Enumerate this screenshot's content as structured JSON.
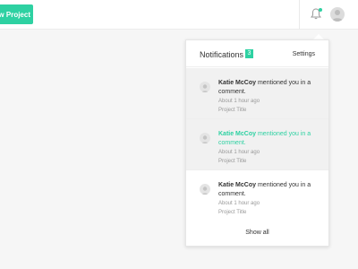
{
  "topbar": {
    "new_project_label": "New Project",
    "bell_icon": "bell-icon",
    "avatar_icon": "user-avatar-icon"
  },
  "colors": {
    "accent": "#2ed1a2",
    "unread_bg": "#f1f1f1"
  },
  "notifications": {
    "title": "Notifications",
    "count": "3",
    "settings_label": "Settings",
    "items": [
      {
        "user": "Katie McCoy",
        "message": "mentioned you in a comment.",
        "time": "About 1 hour ago",
        "project": "Project Title",
        "state": "unread"
      },
      {
        "user": "Katie McCoy",
        "message": "mentioned you in a comment.",
        "time": "About 1 hour ago",
        "project": "Project Title",
        "state": "unread-highlight"
      },
      {
        "user": "Katie McCoy",
        "message": "mentioned you in a comment.",
        "time": "About 1 hour ago",
        "project": "Project Title",
        "state": "read"
      }
    ],
    "show_all_label": "Show all"
  }
}
